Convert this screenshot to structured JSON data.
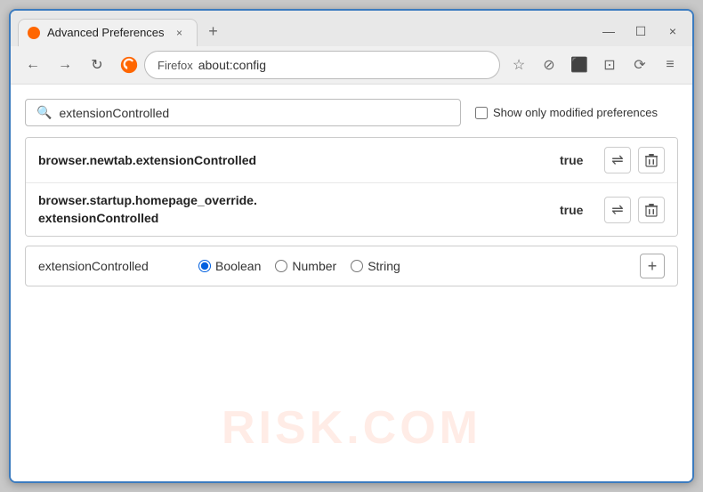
{
  "window": {
    "title": "Advanced Preferences",
    "tab_close": "×",
    "new_tab": "+",
    "minimize": "—",
    "maximize": "☐",
    "close": "×"
  },
  "navbar": {
    "back": "←",
    "forward": "→",
    "refresh": "↻",
    "brand": "Firefox",
    "address": "about:config",
    "bookmark_icon": "☆",
    "pocket_icon": "⊘",
    "extension_icon": "⬛",
    "shield_icon": "⊡",
    "sync_icon": "⟳",
    "menu_icon": "≡"
  },
  "content": {
    "search_placeholder": "extensionControlled",
    "search_value": "extensionControlled",
    "show_modified_label": "Show only modified preferences",
    "watermark": "RISK.COM",
    "results": [
      {
        "name": "browser.newtab.extensionControlled",
        "value": "true",
        "multiline": false
      },
      {
        "name1": "browser.startup.homepage_override.",
        "name2": "extensionControlled",
        "value": "true",
        "multiline": true
      }
    ],
    "new_pref": {
      "name": "extensionControlled",
      "type_boolean": "Boolean",
      "type_number": "Number",
      "type_string": "String",
      "selected_type": "Boolean"
    },
    "icons": {
      "swap": "⇌",
      "delete": "🗑",
      "plus": "+"
    }
  }
}
